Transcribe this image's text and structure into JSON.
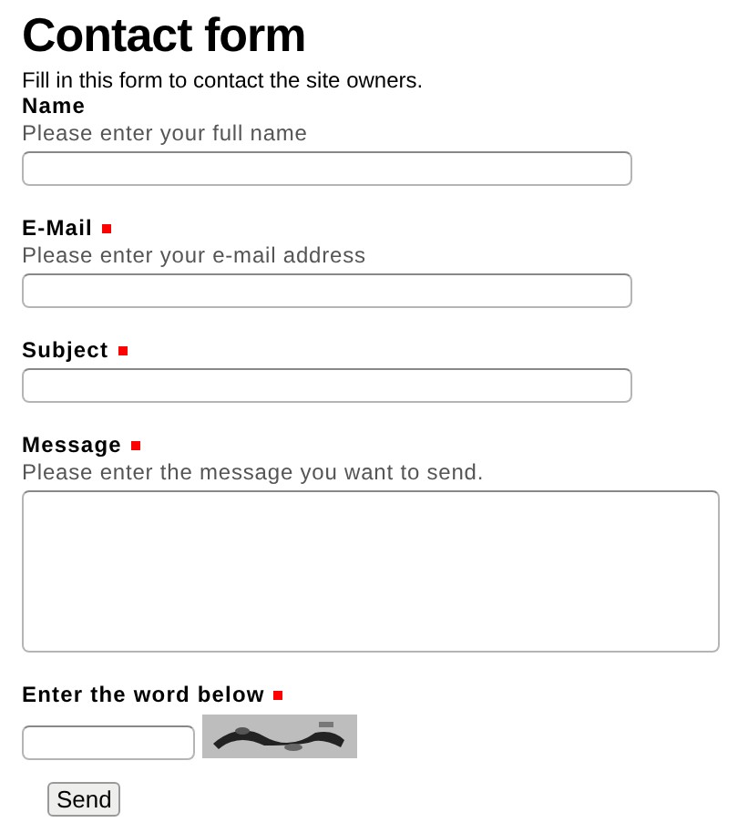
{
  "title": "Contact form",
  "intro": "Fill in this form to contact the site owners.",
  "fields": [
    {
      "kind": "text",
      "label": "Name",
      "required": false,
      "hint": "Please enter your full name"
    },
    {
      "kind": "text",
      "label": "E-Mail",
      "required": true,
      "hint": "Please enter your e-mail address"
    },
    {
      "kind": "text",
      "label": "Subject",
      "required": true
    },
    {
      "kind": "textarea",
      "label": "Message",
      "required": true,
      "hint": "Please enter the message you want to send."
    },
    {
      "kind": "captcha",
      "label": "Enter the word below",
      "required": true
    }
  ],
  "submit": "Send"
}
